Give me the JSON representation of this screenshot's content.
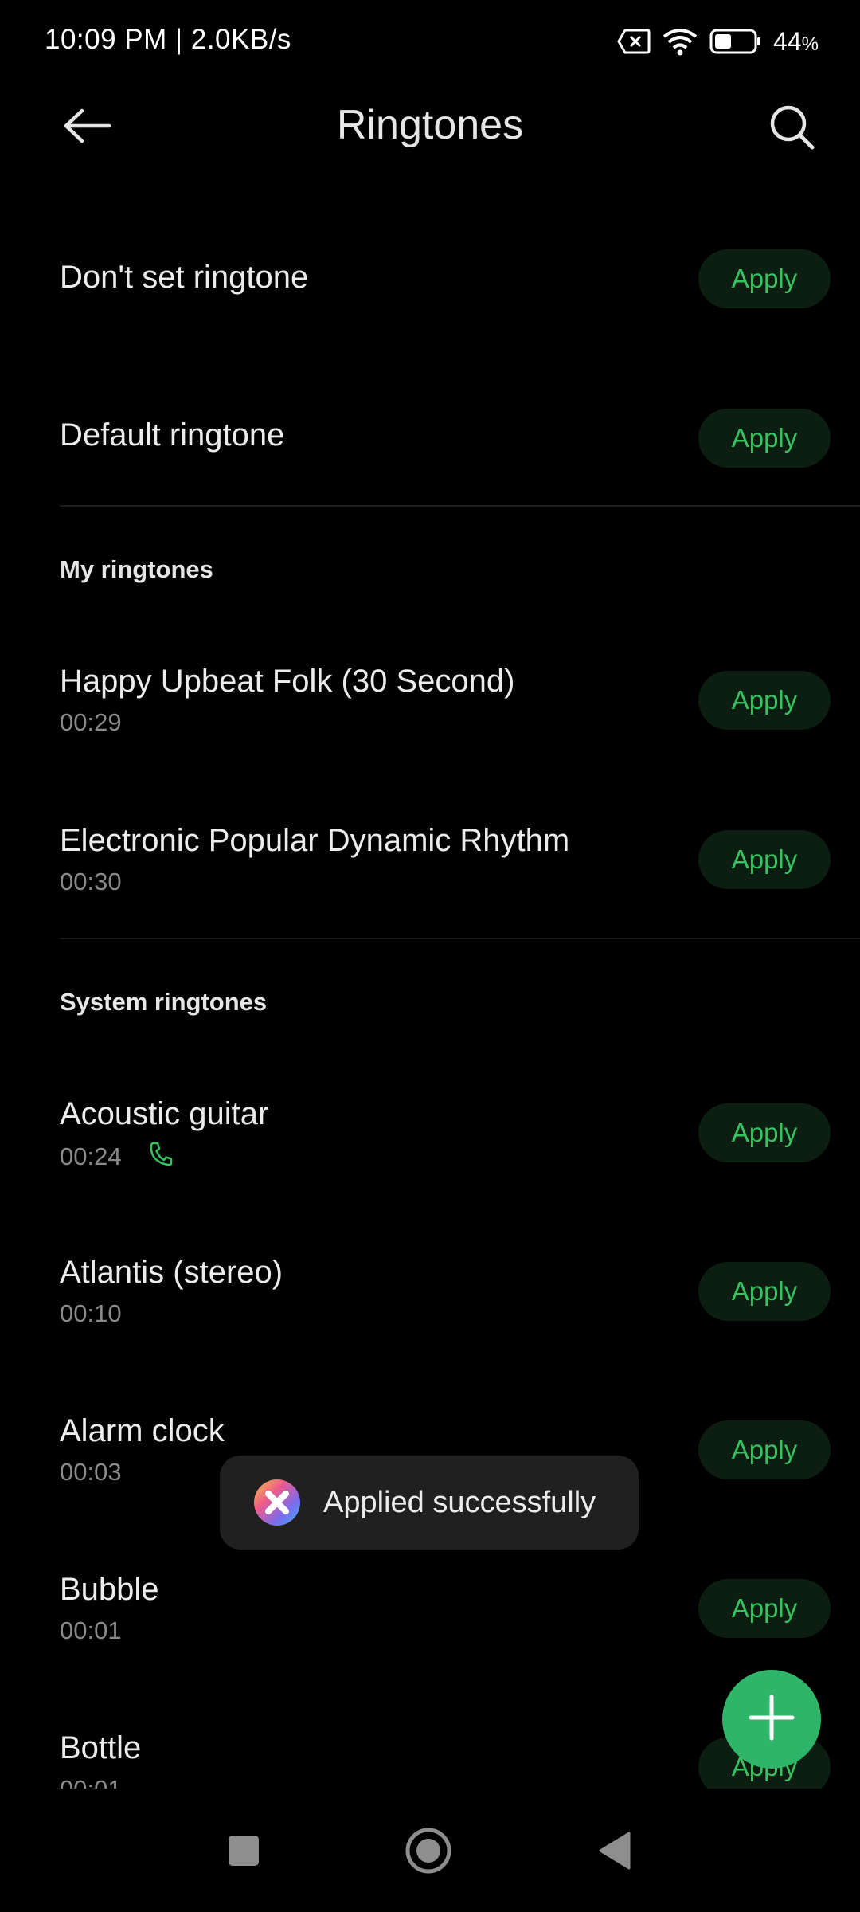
{
  "status_bar": {
    "time": "10:09 PM | 2.0KB/s",
    "battery_percent": "44",
    "battery_suffix": "%",
    "battery_level": 0.44
  },
  "header": {
    "title": "Ringtones",
    "back_icon": "arrow-left-icon",
    "search_icon": "search-icon"
  },
  "top_options": [
    {
      "title": "Don't set ringtone",
      "apply_label": "Apply"
    },
    {
      "title": "Default ringtone",
      "apply_label": "Apply"
    }
  ],
  "my_ringtones": {
    "header": "My ringtones",
    "items": [
      {
        "title": "Happy Upbeat Folk (30 Second)",
        "duration": "00:29",
        "apply_label": "Apply"
      },
      {
        "title": "Electronic Popular Dynamic Rhythm",
        "duration": "00:30",
        "apply_label": "Apply"
      }
    ]
  },
  "system_ringtones": {
    "header": "System ringtones",
    "items": [
      {
        "title": "Acoustic guitar",
        "duration": "00:24",
        "apply_label": "Apply",
        "current_call_ringtone": true
      },
      {
        "title": "Atlantis (stereo)",
        "duration": "00:10",
        "apply_label": "Apply"
      },
      {
        "title": "Alarm clock",
        "duration": "00:03",
        "apply_label": "Apply"
      },
      {
        "title": "Bubble",
        "duration": "00:01",
        "apply_label": "Apply"
      },
      {
        "title": "Bottle",
        "duration": "00:01",
        "apply_label": "Apply"
      }
    ]
  },
  "toast": {
    "text": "Applied successfully"
  },
  "fab": {
    "icon": "plus-icon"
  },
  "colors": {
    "background": "#000000",
    "accent_green": "#34c35e",
    "fab_green": "#2fb56a",
    "apply_button_bg": "#0b1e11",
    "secondary_text": "#8a8a8a"
  },
  "nav_bar": {
    "recents_icon": "square-icon",
    "home_icon": "circle-icon",
    "back_icon": "triangle-back-icon"
  }
}
